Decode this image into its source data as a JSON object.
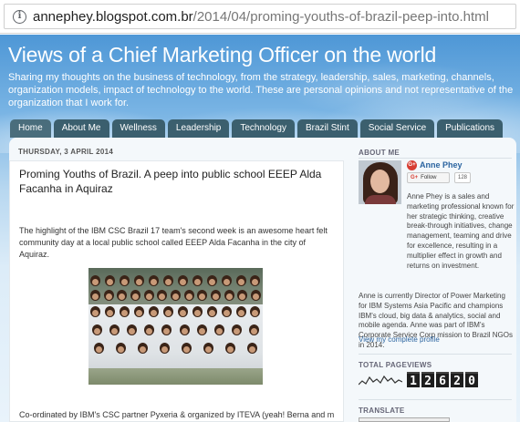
{
  "browser": {
    "url_host": "annephey.blogspot.com.br",
    "url_path": "/2014/04/proming-youths-of-brazil-peep-into.html",
    "info_icon": "info-icon"
  },
  "blog": {
    "title": "Views of a Chief Marketing Officer on the world",
    "description": "Sharing my thoughts on the business of technology, from the strategy, leadership, sales, marketing, channels, organization models, impact of technology to the world. These are personal opinions and not representative of the organization that I work for."
  },
  "nav": {
    "tabs": [
      {
        "label": "Home"
      },
      {
        "label": "About Me"
      },
      {
        "label": "Wellness"
      },
      {
        "label": "Leadership"
      },
      {
        "label": "Technology"
      },
      {
        "label": "Brazil Stint"
      },
      {
        "label": "Social Service"
      },
      {
        "label": "Publications"
      }
    ]
  },
  "post": {
    "date": "THURSDAY, 3 APRIL 2014",
    "title": "Proming Youths of Brazil. A peep into public school EEEP Alda Facanha in Aquiraz",
    "paragraph1": "The highlight of the IBM CSC Brazil 17 team's second week is an awesome heart felt community day at a local public school called EEEP Alda Facanha in the city of Aquiraz.",
    "paragraph2": "Co-ordinated by IBM's CSC partner Pyxeria & organized by ITEVA (yeah! Berna and my"
  },
  "sidebar": {
    "about_heading": "ABOUT ME",
    "profile_name": "Anne Phey",
    "follow_label": "Follow",
    "follower_count": "128",
    "bio1": "Anne Phey is a sales and marketing professional known for her strategic thinking, creative break-through initiatives, change management, teaming and drive for excellence, resulting in a multiplier effect in growth and returns on investment.",
    "bio2": "Anne is currently Director of Power Marketing for IBM Systems Asia Pacific and champions IBM's cloud, big data & analytics, social and mobile agenda. Anne was part of IBM's Corporate Service Corp mission to Brazil NGOs in 2014.",
    "profile_link": "View my complete profile",
    "pageviews_heading": "TOTAL PAGEVIEWS",
    "pageviews_digits": [
      "1",
      "2",
      "6",
      "2",
      "0"
    ],
    "translate_heading": "TRANSLATE"
  },
  "colors": {
    "tab": "#3b5f6e",
    "link": "#2b64a0",
    "header_blue": "#4e97d6"
  }
}
